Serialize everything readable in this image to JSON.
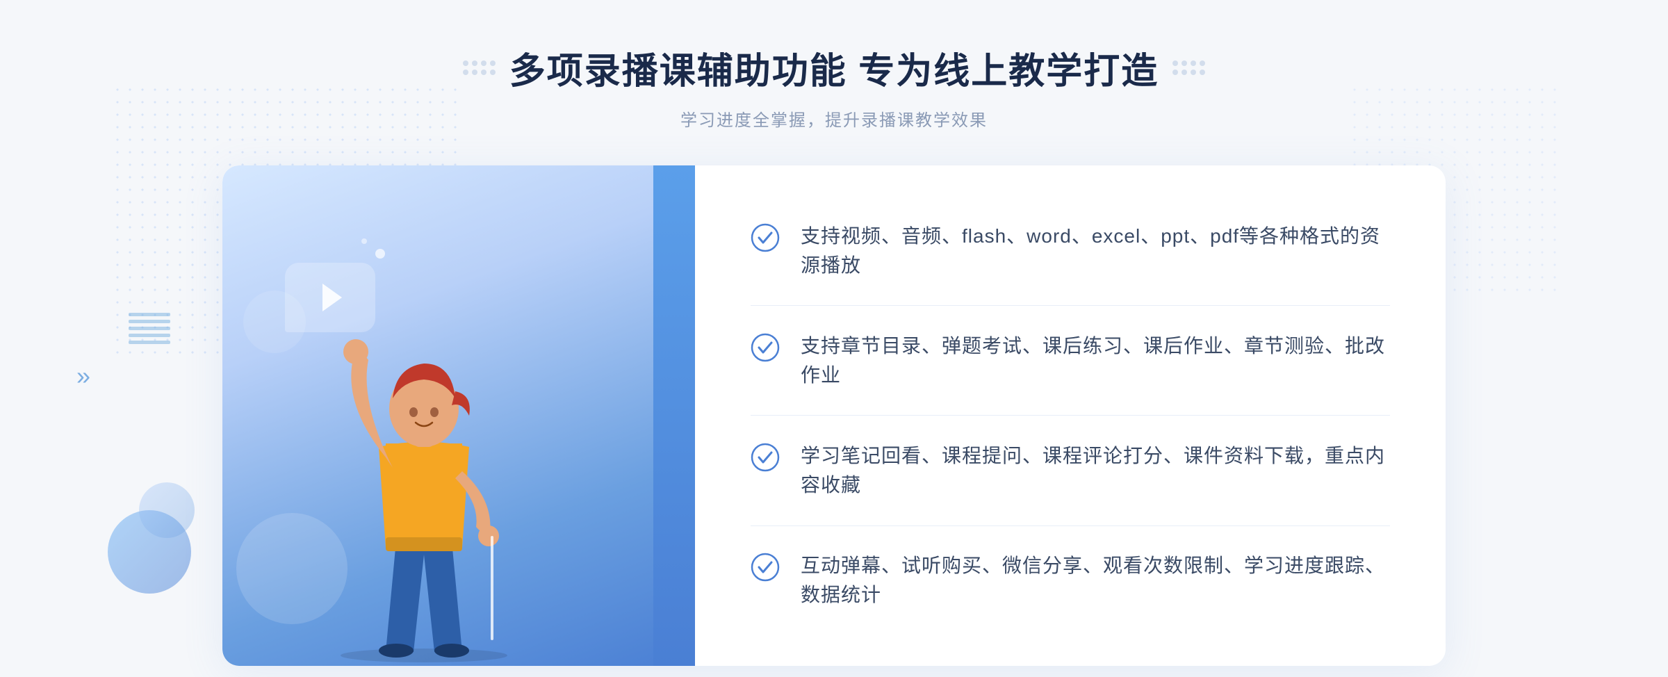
{
  "page": {
    "background_color": "#f5f7fa"
  },
  "header": {
    "title": "多项录播课辅助功能 专为线上教学打造",
    "subtitle": "学习进度全掌握，提升录播课教学效果",
    "left_decorator": "❖",
    "right_decorator": "❖"
  },
  "features": [
    {
      "id": 1,
      "text": "支持视频、音频、flash、word、excel、ppt、pdf等各种格式的资源播放"
    },
    {
      "id": 2,
      "text": "支持章节目录、弹题考试、课后练习、课后作业、章节测验、批改作业"
    },
    {
      "id": 3,
      "text": "学习笔记回看、课程提问、课程评论打分、课件资料下载，重点内容收藏"
    },
    {
      "id": 4,
      "text": "互动弹幕、试听购买、微信分享、观看次数限制、学习进度跟踪、数据统计"
    }
  ],
  "colors": {
    "primary_blue": "#4a7fd4",
    "light_blue": "#6a9fe0",
    "text_dark": "#1a2a4a",
    "text_medium": "#3a4a65",
    "text_light": "#8a9ab5",
    "check_color": "#4a7fd4",
    "divider_color": "#e8eef8"
  },
  "icons": {
    "check": "circle-check",
    "play": "play-triangle"
  }
}
